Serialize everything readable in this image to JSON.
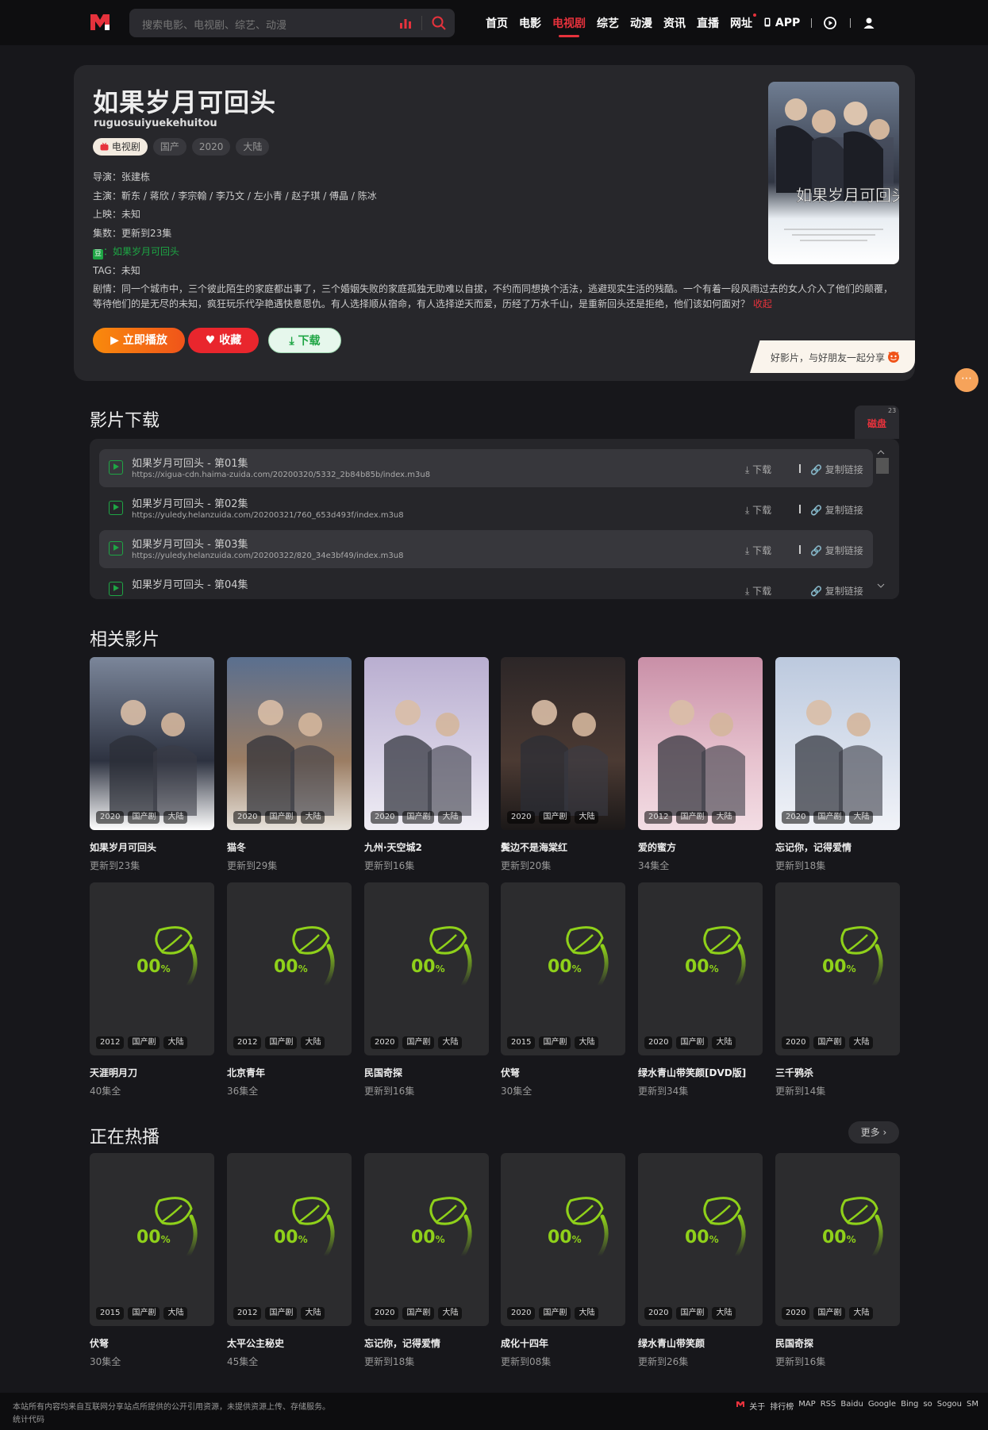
{
  "header": {
    "search_placeholder": "搜索电影、电视剧、综艺、动漫",
    "nav": [
      "首页",
      "电影",
      "电视剧",
      "综艺",
      "动漫",
      "资讯",
      "直播",
      "网址",
      "APP"
    ],
    "active_nav": "电视剧"
  },
  "detail": {
    "title": "如果岁月可回头",
    "pinyin": "ruguosuiyuekehuitou",
    "tags": [
      "电视剧",
      "国产",
      "2020",
      "大陆"
    ],
    "director_label": "导演：",
    "director": "张建栋",
    "cast_label": "主演：",
    "cast": "靳东 / 蒋欣 / 李宗翰 / 李乃文 / 左小青 / 赵子琪 / 傅晶 / 陈冰",
    "release_label": "上映：",
    "release": "未知",
    "episodes_label": "集数：",
    "episodes": "更新到23集",
    "douban_icon": "豆",
    "douban": "：如果岁月可回头",
    "tag_label": "TAG：",
    "tag": "未知",
    "plot_label": "剧情：",
    "plot": "同一个城市中，三个彼此陌生的家庭都出事了，三个婚姻失败的家庭孤独无助难以自拔，不约而同想换个活法，逃避现实生活的残酷。一个有着一段风雨过去的女人介入了他们的颠覆，等待他们的是无尽的未知，疯狂玩乐代孕艳遇快意恩仇。有人选择顺从宿命，有人选择逆天而爱，历经了万水千山，是重新回头还是拒绝，他们该如何面对？",
    "collapse": "收起",
    "play_button": "立即播放",
    "fav_button": "收藏",
    "download_button": "下载",
    "share_text": "好影片，与好朋友一起分享"
  },
  "download": {
    "heading": "影片下载",
    "tab_label": "磁盘",
    "tab_count": "23",
    "download_label": "下载",
    "copy_label": "复制链接",
    "items": [
      {
        "name": "如果岁月可回头 - 第01集",
        "url": "https://xigua-cdn.haima-zuida.com/20200320/5332_2b84b85b/index.m3u8"
      },
      {
        "name": "如果岁月可回头 - 第02集",
        "url": "https://yuledy.helanzuida.com/20200321/760_653d493f/index.m3u8"
      },
      {
        "name": "如果岁月可回头 - 第03集",
        "url": "https://yuledy.helanzuida.com/20200322/820_34e3bf49/index.m3u8"
      },
      {
        "name": "如果岁月可回头 - 第04集",
        "url": ""
      }
    ]
  },
  "related": {
    "heading": "相关影片",
    "items": [
      {
        "title": "如果岁月可回头",
        "status": "更新到23集",
        "year": "2020",
        "genre": "国产剧",
        "region": "大陆"
      },
      {
        "title": "猫冬",
        "status": "更新到29集",
        "year": "2020",
        "genre": "国产剧",
        "region": "大陆"
      },
      {
        "title": "九州·天空城2",
        "status": "更新到16集",
        "year": "2020",
        "genre": "国产剧",
        "region": "大陆"
      },
      {
        "title": "鬓边不是海棠红",
        "status": "更新到20集",
        "year": "2020",
        "genre": "国产剧",
        "region": "大陆"
      },
      {
        "title": "爱的蜜方",
        "status": "34集全",
        "year": "2012",
        "genre": "国产剧",
        "region": "大陆"
      },
      {
        "title": "忘记你，记得爱情",
        "status": "更新到18集",
        "year": "2020",
        "genre": "国产剧",
        "region": "大陆"
      },
      {
        "title": "天涯明月刀",
        "status": "40集全",
        "year": "2012",
        "genre": "国产剧",
        "region": "大陆"
      },
      {
        "title": "北京青年",
        "status": "36集全",
        "year": "2012",
        "genre": "国产剧",
        "region": "大陆"
      },
      {
        "title": "民国奇探",
        "status": "更新到16集",
        "year": "2020",
        "genre": "国产剧",
        "region": "大陆"
      },
      {
        "title": "伏弩",
        "status": "30集全",
        "year": "2015",
        "genre": "国产剧",
        "region": "大陆"
      },
      {
        "title": "绿水青山带笑颜[DVD版]",
        "status": "更新到34集",
        "year": "2020",
        "genre": "国产剧",
        "region": "大陆"
      },
      {
        "title": "三千鸦杀",
        "status": "更新到14集",
        "year": "2020",
        "genre": "国产剧",
        "region": "大陆"
      }
    ]
  },
  "hot": {
    "heading": "正在热播",
    "more": "更多",
    "items": [
      {
        "title": "伏弩",
        "status": "30集全",
        "year": "2015",
        "genre": "国产剧",
        "region": "大陆"
      },
      {
        "title": "太平公主秘史",
        "status": "45集全",
        "year": "2012",
        "genre": "国产剧",
        "region": "大陆"
      },
      {
        "title": "忘记你，记得爱情",
        "status": "更新到18集",
        "year": "2020",
        "genre": "国产剧",
        "region": "大陆"
      },
      {
        "title": "成化十四年",
        "status": "更新到08集",
        "year": "2020",
        "genre": "国产剧",
        "region": "大陆"
      },
      {
        "title": "绿水青山带笑颜",
        "status": "更新到26集",
        "year": "2020",
        "genre": "国产剧",
        "region": "大陆"
      },
      {
        "title": "民国奇探",
        "status": "更新到16集",
        "year": "2020",
        "genre": "国产剧",
        "region": "大陆"
      }
    ]
  },
  "loading_text": "00",
  "loading_unit": "%",
  "footer": {
    "disclaimer": "本站所有内容均来自互联网分享站点所提供的公开引用资源，未提供资源上传、存储服务。",
    "stats": "统计代码",
    "links": [
      "关于",
      "排行榜",
      "MAP",
      "RSS",
      "Baidu",
      "Google",
      "Bing",
      "so",
      "Sogou",
      "SM"
    ]
  },
  "colors": {
    "accent": "#e6323c",
    "green": "#1ea544",
    "orange": "#f98a0c",
    "bg": "#17171b"
  }
}
